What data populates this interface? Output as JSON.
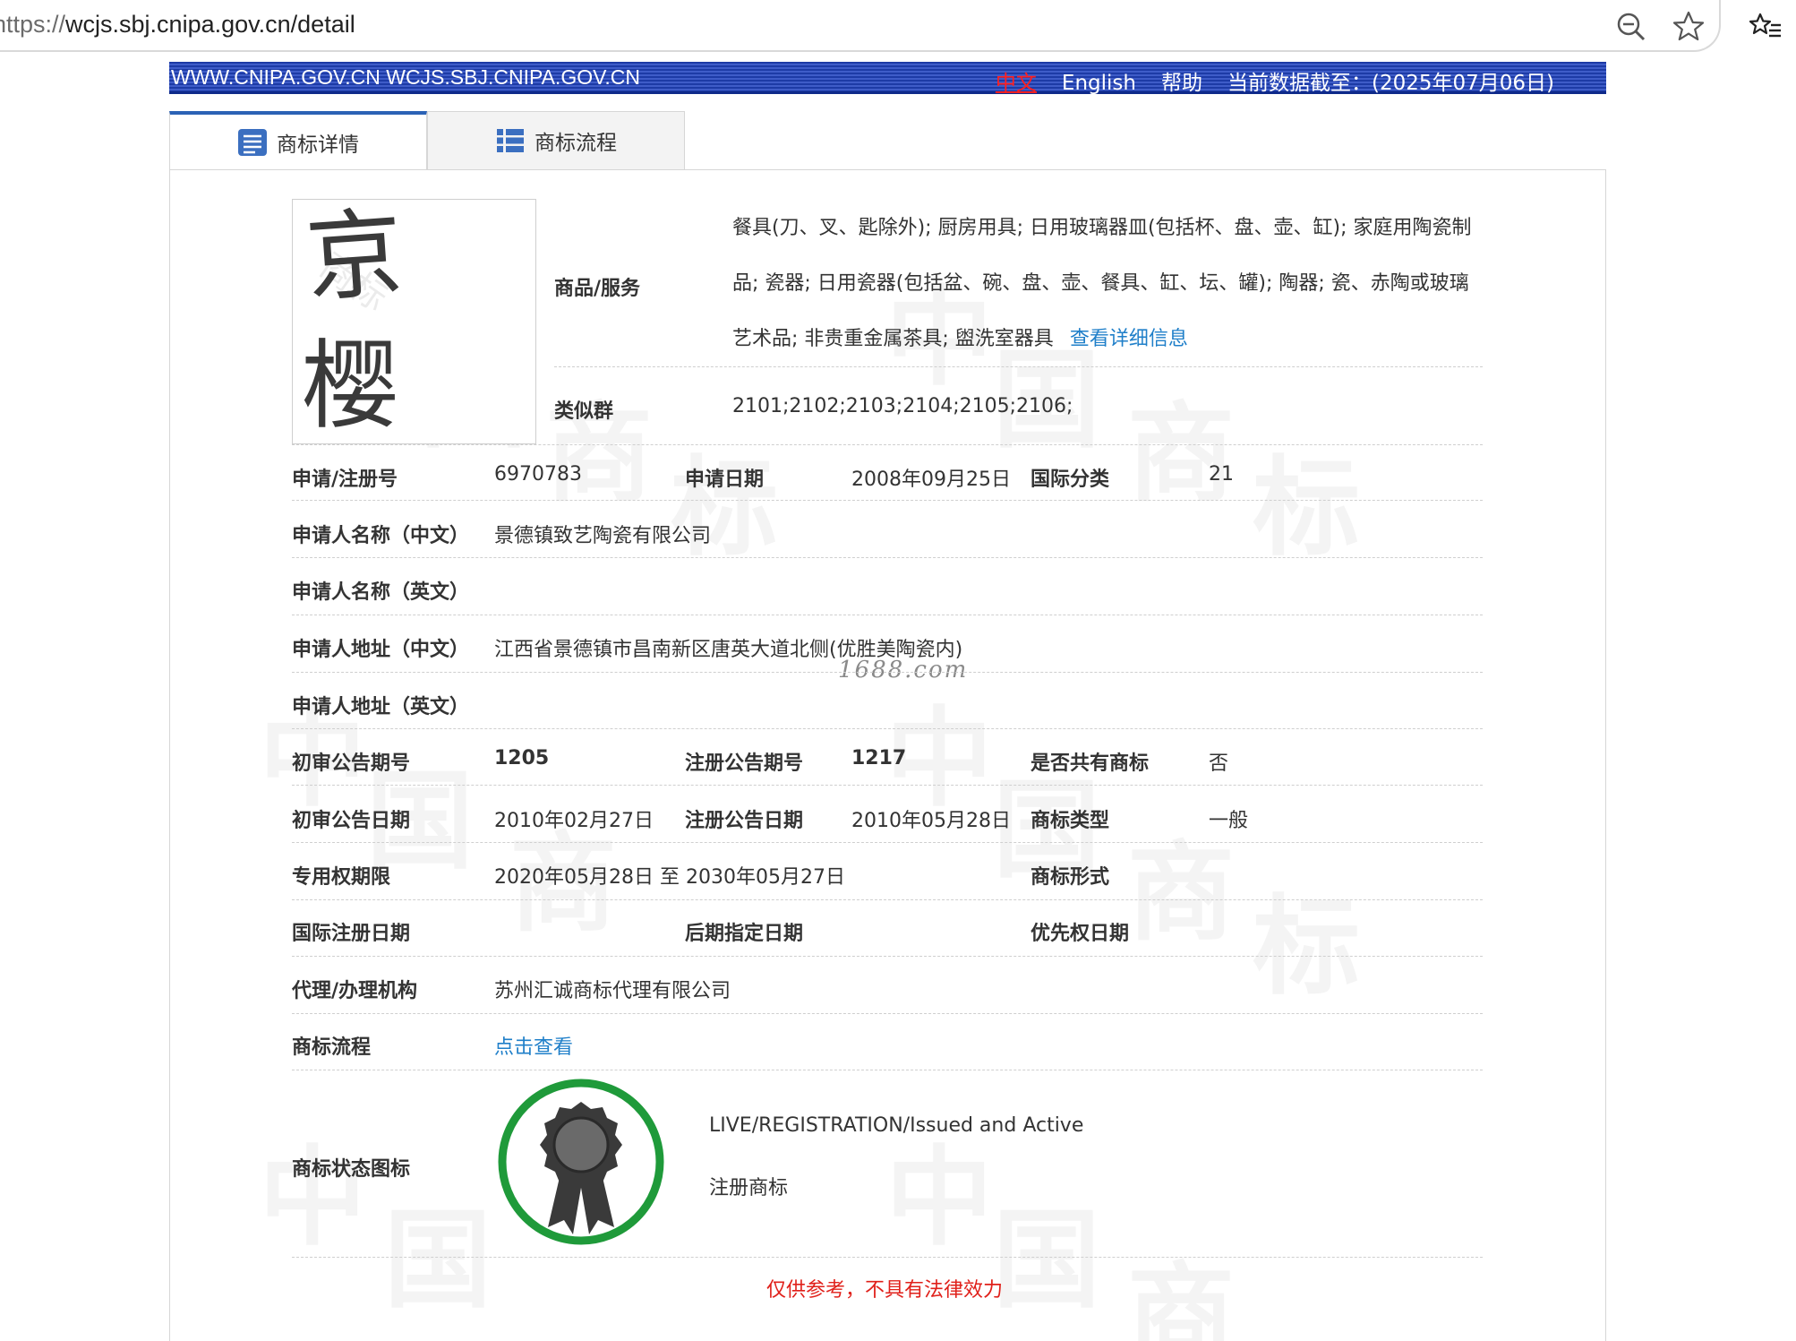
{
  "browser": {
    "url_scheme": "https://",
    "url_rest": "wcjs.sbj.cnipa.gov.cn/detail"
  },
  "banner": {
    "site": "WWW.CNIPA.GOV.CN WCJS.SBJ.CNIPA.GOV.CN",
    "lang_zh": "中文",
    "lang_en": "English",
    "help": "帮助",
    "data_date": "当前数据截至：(2025年07月06日)"
  },
  "tabs": {
    "detail": "商标详情",
    "flow": "商标流程"
  },
  "trademark": {
    "char1": "京",
    "char2": "樱"
  },
  "goods": {
    "label": "商品/服务",
    "text": "餐具(刀、叉、匙除外); 厨房用具; 日用玻璃器皿(包括杯、盘、壶、缸); 家庭用陶瓷制品; 瓷器; 日用瓷器(包括盆、碗、盘、壶、餐具、缸、坛、罐); 陶器; 瓷、赤陶或玻璃艺术品; 非贵重金属茶具; 盥洗室器具",
    "more_link": "查看详细信息"
  },
  "similar_group": {
    "label": "类似群",
    "value": "2101;2102;2103;2104;2105;2106;"
  },
  "fields": {
    "reg_no_label": "申请/注册号",
    "reg_no": "6970783",
    "apply_date_label": "申请日期",
    "apply_date": "2008年09月25日",
    "intl_class_label": "国际分类",
    "intl_class": "21",
    "applicant_cn_label": "申请人名称（中文）",
    "applicant_cn": "景德镇致艺陶瓷有限公司",
    "applicant_en_label": "申请人名称（英文）",
    "applicant_en": "",
    "address_cn_label": "申请人地址（中文）",
    "address_cn": "江西省景德镇市昌南新区唐英大道北侧(优胜美陶瓷内)",
    "address_en_label": "申请人地址（英文）",
    "address_en": "",
    "prelim_issue_label": "初审公告期号",
    "prelim_issue": "1205",
    "reg_issue_label": "注册公告期号",
    "reg_issue": "1217",
    "shared_label": "是否共有商标",
    "shared": "否",
    "prelim_date_label": "初审公告日期",
    "prelim_date": "2010年02月27日",
    "reg_date_label": "注册公告日期",
    "reg_date": "2010年05月28日",
    "tm_type_label": "商标类型",
    "tm_type": "一般",
    "exclusive_label": "专用权期限",
    "exclusive": "2020年05月28日 至 2030年05月27日",
    "tm_form_label": "商标形式",
    "intl_reg_date_label": "国际注册日期",
    "later_designation_label": "后期指定日期",
    "priority_date_label": "优先权日期",
    "agent_label": "代理/办理机构",
    "agent": "苏州汇诚商标代理有限公司",
    "flow_label": "商标流程",
    "flow_link": "点击查看",
    "status_icon_label": "商标状态图标",
    "status_en": "LIVE/REGISTRATION/Issued and Active",
    "status_cn": "注册商标"
  },
  "overlay_watermark": "1688.com",
  "disclaimer": "仅供参考，不具有法律效力",
  "colors": {
    "banner_blue": "#1d3ba6",
    "link_blue": "#1f7fc9",
    "status_green": "#1f9a3a",
    "disclaimer_red": "#e0201a"
  }
}
